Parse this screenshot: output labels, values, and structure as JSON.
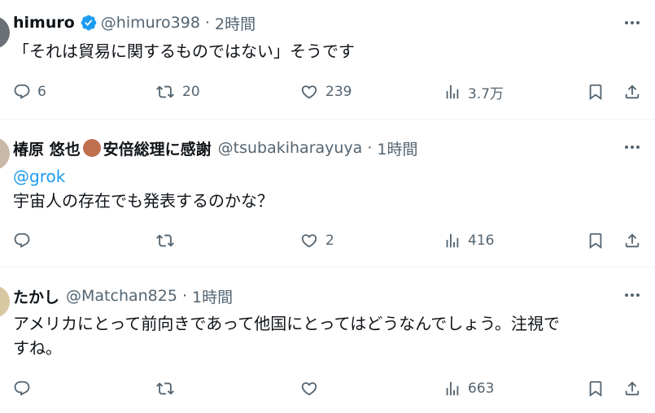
{
  "tweets": [
    {
      "name": "himuro",
      "handle": "@himuro398",
      "time": "2時間",
      "verified": true,
      "text_lines": [
        "「それは貿易に関するものではない」そうです"
      ],
      "replies": "6",
      "retweets": "20",
      "likes": "239",
      "views": "3.7万"
    },
    {
      "name_part1": "椿原 悠也",
      "name_part2": "安倍総理に感謝",
      "handle": "@tsubakiharayuya",
      "time": "1時間",
      "mention": "@grok",
      "text_lines": [
        "宇宙人の存在でも発表するのかな？"
      ],
      "replies": "",
      "retweets": "",
      "likes": "2",
      "views": "416"
    },
    {
      "name": "たかし",
      "handle": "@Matchan825",
      "time": "1時間",
      "text_lines": [
        "アメリカにとって前向きであって他国にとってはどうなんでしょう。注視で",
        "すね。"
      ],
      "replies": "",
      "retweets": "",
      "likes": "",
      "views": "663"
    }
  ],
  "separator": "·",
  "colors": {
    "accent": "#1d9bf0",
    "secondary_text": "#536471",
    "text": "#0f1419",
    "divider": "#eff3f4",
    "name_emoji": "#c0704e"
  },
  "icons": [
    "verified-badge-icon",
    "more-icon",
    "reply-icon",
    "retweet-icon",
    "like-icon",
    "views-icon",
    "bookmark-icon",
    "share-icon"
  ]
}
